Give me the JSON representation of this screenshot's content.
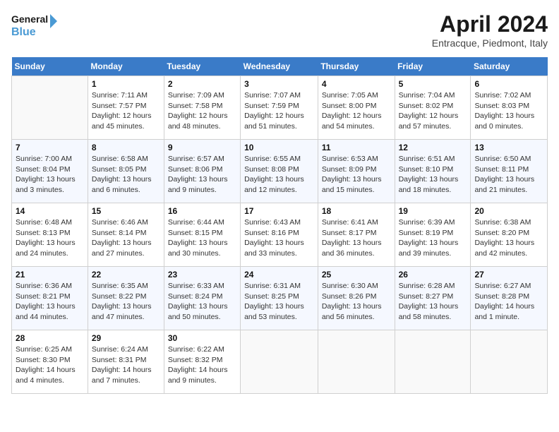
{
  "logo": {
    "line1": "General",
    "line2": "Blue"
  },
  "title": "April 2024",
  "subtitle": "Entracque, Piedmont, Italy",
  "weekdays": [
    "Sunday",
    "Monday",
    "Tuesday",
    "Wednesday",
    "Thursday",
    "Friday",
    "Saturday"
  ],
  "weeks": [
    [
      {
        "num": "",
        "sunrise": "",
        "sunset": "",
        "daylight": ""
      },
      {
        "num": "1",
        "sunrise": "Sunrise: 7:11 AM",
        "sunset": "Sunset: 7:57 PM",
        "daylight": "Daylight: 12 hours and 45 minutes."
      },
      {
        "num": "2",
        "sunrise": "Sunrise: 7:09 AM",
        "sunset": "Sunset: 7:58 PM",
        "daylight": "Daylight: 12 hours and 48 minutes."
      },
      {
        "num": "3",
        "sunrise": "Sunrise: 7:07 AM",
        "sunset": "Sunset: 7:59 PM",
        "daylight": "Daylight: 12 hours and 51 minutes."
      },
      {
        "num": "4",
        "sunrise": "Sunrise: 7:05 AM",
        "sunset": "Sunset: 8:00 PM",
        "daylight": "Daylight: 12 hours and 54 minutes."
      },
      {
        "num": "5",
        "sunrise": "Sunrise: 7:04 AM",
        "sunset": "Sunset: 8:02 PM",
        "daylight": "Daylight: 12 hours and 57 minutes."
      },
      {
        "num": "6",
        "sunrise": "Sunrise: 7:02 AM",
        "sunset": "Sunset: 8:03 PM",
        "daylight": "Daylight: 13 hours and 0 minutes."
      }
    ],
    [
      {
        "num": "7",
        "sunrise": "Sunrise: 7:00 AM",
        "sunset": "Sunset: 8:04 PM",
        "daylight": "Daylight: 13 hours and 3 minutes."
      },
      {
        "num": "8",
        "sunrise": "Sunrise: 6:58 AM",
        "sunset": "Sunset: 8:05 PM",
        "daylight": "Daylight: 13 hours and 6 minutes."
      },
      {
        "num": "9",
        "sunrise": "Sunrise: 6:57 AM",
        "sunset": "Sunset: 8:06 PM",
        "daylight": "Daylight: 13 hours and 9 minutes."
      },
      {
        "num": "10",
        "sunrise": "Sunrise: 6:55 AM",
        "sunset": "Sunset: 8:08 PM",
        "daylight": "Daylight: 13 hours and 12 minutes."
      },
      {
        "num": "11",
        "sunrise": "Sunrise: 6:53 AM",
        "sunset": "Sunset: 8:09 PM",
        "daylight": "Daylight: 13 hours and 15 minutes."
      },
      {
        "num": "12",
        "sunrise": "Sunrise: 6:51 AM",
        "sunset": "Sunset: 8:10 PM",
        "daylight": "Daylight: 13 hours and 18 minutes."
      },
      {
        "num": "13",
        "sunrise": "Sunrise: 6:50 AM",
        "sunset": "Sunset: 8:11 PM",
        "daylight": "Daylight: 13 hours and 21 minutes."
      }
    ],
    [
      {
        "num": "14",
        "sunrise": "Sunrise: 6:48 AM",
        "sunset": "Sunset: 8:13 PM",
        "daylight": "Daylight: 13 hours and 24 minutes."
      },
      {
        "num": "15",
        "sunrise": "Sunrise: 6:46 AM",
        "sunset": "Sunset: 8:14 PM",
        "daylight": "Daylight: 13 hours and 27 minutes."
      },
      {
        "num": "16",
        "sunrise": "Sunrise: 6:44 AM",
        "sunset": "Sunset: 8:15 PM",
        "daylight": "Daylight: 13 hours and 30 minutes."
      },
      {
        "num": "17",
        "sunrise": "Sunrise: 6:43 AM",
        "sunset": "Sunset: 8:16 PM",
        "daylight": "Daylight: 13 hours and 33 minutes."
      },
      {
        "num": "18",
        "sunrise": "Sunrise: 6:41 AM",
        "sunset": "Sunset: 8:17 PM",
        "daylight": "Daylight: 13 hours and 36 minutes."
      },
      {
        "num": "19",
        "sunrise": "Sunrise: 6:39 AM",
        "sunset": "Sunset: 8:19 PM",
        "daylight": "Daylight: 13 hours and 39 minutes."
      },
      {
        "num": "20",
        "sunrise": "Sunrise: 6:38 AM",
        "sunset": "Sunset: 8:20 PM",
        "daylight": "Daylight: 13 hours and 42 minutes."
      }
    ],
    [
      {
        "num": "21",
        "sunrise": "Sunrise: 6:36 AM",
        "sunset": "Sunset: 8:21 PM",
        "daylight": "Daylight: 13 hours and 44 minutes."
      },
      {
        "num": "22",
        "sunrise": "Sunrise: 6:35 AM",
        "sunset": "Sunset: 8:22 PM",
        "daylight": "Daylight: 13 hours and 47 minutes."
      },
      {
        "num": "23",
        "sunrise": "Sunrise: 6:33 AM",
        "sunset": "Sunset: 8:24 PM",
        "daylight": "Daylight: 13 hours and 50 minutes."
      },
      {
        "num": "24",
        "sunrise": "Sunrise: 6:31 AM",
        "sunset": "Sunset: 8:25 PM",
        "daylight": "Daylight: 13 hours and 53 minutes."
      },
      {
        "num": "25",
        "sunrise": "Sunrise: 6:30 AM",
        "sunset": "Sunset: 8:26 PM",
        "daylight": "Daylight: 13 hours and 56 minutes."
      },
      {
        "num": "26",
        "sunrise": "Sunrise: 6:28 AM",
        "sunset": "Sunset: 8:27 PM",
        "daylight": "Daylight: 13 hours and 58 minutes."
      },
      {
        "num": "27",
        "sunrise": "Sunrise: 6:27 AM",
        "sunset": "Sunset: 8:28 PM",
        "daylight": "Daylight: 14 hours and 1 minute."
      }
    ],
    [
      {
        "num": "28",
        "sunrise": "Sunrise: 6:25 AM",
        "sunset": "Sunset: 8:30 PM",
        "daylight": "Daylight: 14 hours and 4 minutes."
      },
      {
        "num": "29",
        "sunrise": "Sunrise: 6:24 AM",
        "sunset": "Sunset: 8:31 PM",
        "daylight": "Daylight: 14 hours and 7 minutes."
      },
      {
        "num": "30",
        "sunrise": "Sunrise: 6:22 AM",
        "sunset": "Sunset: 8:32 PM",
        "daylight": "Daylight: 14 hours and 9 minutes."
      },
      {
        "num": "",
        "sunrise": "",
        "sunset": "",
        "daylight": ""
      },
      {
        "num": "",
        "sunrise": "",
        "sunset": "",
        "daylight": ""
      },
      {
        "num": "",
        "sunrise": "",
        "sunset": "",
        "daylight": ""
      },
      {
        "num": "",
        "sunrise": "",
        "sunset": "",
        "daylight": ""
      }
    ]
  ]
}
